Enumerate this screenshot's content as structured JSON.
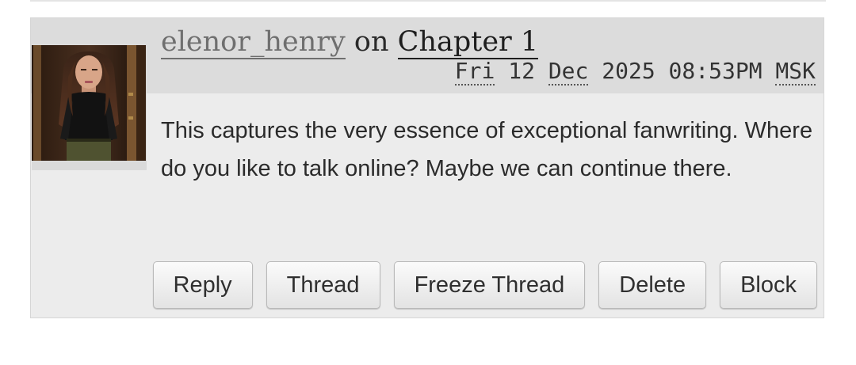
{
  "comment": {
    "author": "elenor_henry",
    "on_word": "on",
    "chapter": "Chapter 1",
    "date": {
      "weekday": "Fri",
      "day": "12",
      "month": "Dec",
      "year": "2025",
      "time": "08:53PM",
      "timezone": "MSK"
    },
    "body": "This captures the very essence of exceptional fanwriting. Where do you like to talk online? Maybe we can continue there.",
    "actions": {
      "reply": "Reply",
      "thread": "Thread",
      "freeze_thread": "Freeze Thread",
      "delete": "Delete",
      "block": "Block"
    }
  },
  "icons": {
    "avatar": "user-avatar-portrait"
  }
}
